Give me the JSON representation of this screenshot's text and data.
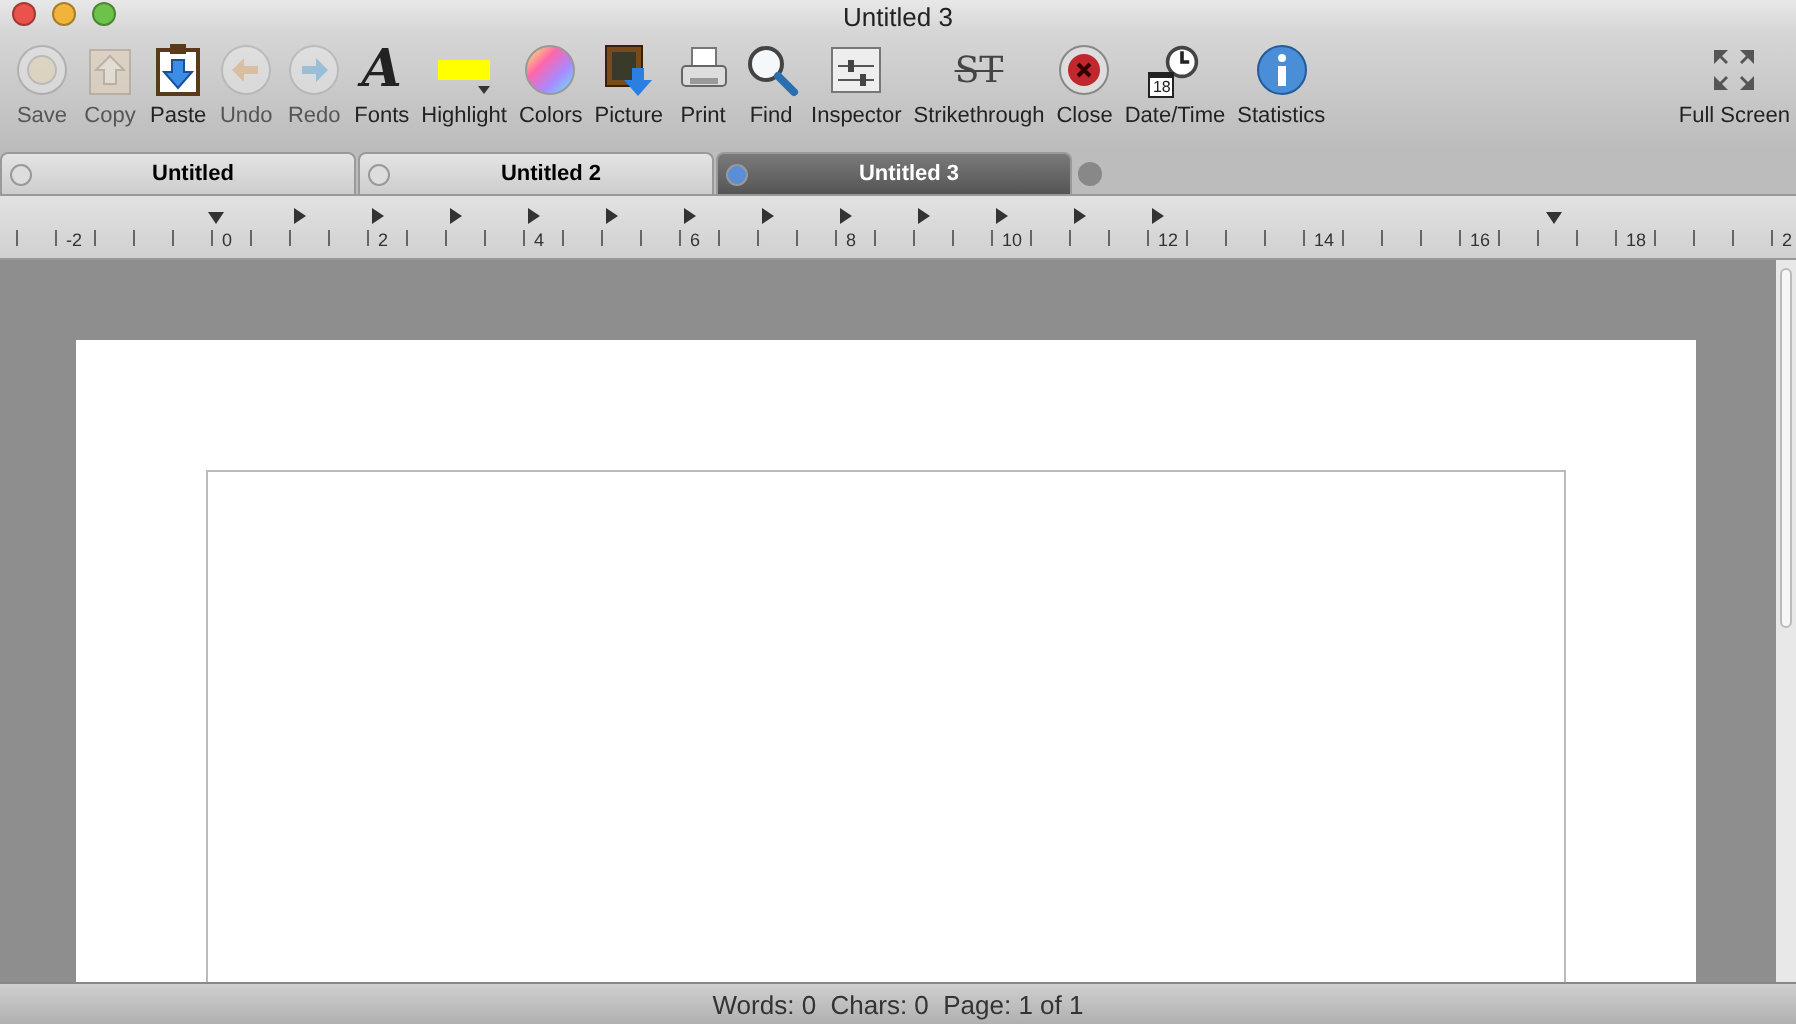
{
  "window": {
    "title": "Untitled 3"
  },
  "toolbar": [
    {
      "kind": "save",
      "label": "Save",
      "disabled": true
    },
    {
      "kind": "copy",
      "label": "Copy",
      "disabled": true
    },
    {
      "kind": "paste",
      "label": "Paste",
      "disabled": false
    },
    {
      "kind": "undo",
      "label": "Undo",
      "disabled": true
    },
    {
      "kind": "redo",
      "label": "Redo",
      "disabled": true
    },
    {
      "kind": "fonts",
      "label": "Fonts",
      "disabled": false,
      "glyph": "A"
    },
    {
      "kind": "highlight",
      "label": "Highlight",
      "disabled": false,
      "color": "#ffff00"
    },
    {
      "kind": "colors",
      "label": "Colors",
      "disabled": false
    },
    {
      "kind": "picture",
      "label": "Picture",
      "disabled": false
    },
    {
      "kind": "print",
      "label": "Print",
      "disabled": false
    },
    {
      "kind": "find",
      "label": "Find",
      "disabled": false
    },
    {
      "kind": "inspector",
      "label": "Inspector",
      "disabled": false
    },
    {
      "kind": "strike",
      "label": "Strikethrough",
      "disabled": false,
      "glyph": "ST"
    },
    {
      "kind": "close",
      "label": "Close",
      "disabled": false
    },
    {
      "kind": "datetime",
      "label": "Date/Time",
      "disabled": false,
      "glyph": "18"
    },
    {
      "kind": "stats",
      "label": "Statistics",
      "disabled": false
    },
    {
      "kind": "spacer"
    },
    {
      "kind": "fullscreen",
      "label": "Full Screen",
      "disabled": false
    }
  ],
  "tabs": [
    {
      "label": "Untitled",
      "selected": false
    },
    {
      "label": "Untitled 2",
      "selected": false
    },
    {
      "label": "Untitled 3",
      "selected": true
    }
  ],
  "ruler": {
    "labels": [
      "-2",
      "0",
      "2",
      "4",
      "6",
      "8",
      "10",
      "12",
      "14",
      "16",
      "18",
      "2"
    ]
  },
  "status_bar": {
    "text": "Words: 0  Chars: 0  Page: 1 of 1"
  }
}
